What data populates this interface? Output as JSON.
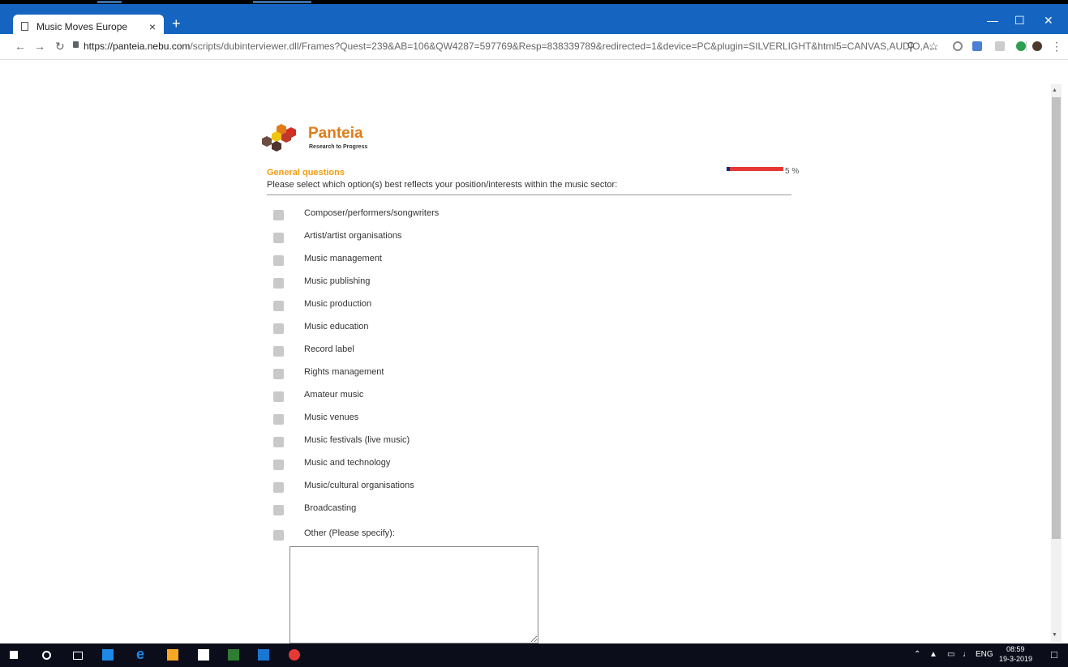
{
  "browser": {
    "tab_title": "Music Moves Europe",
    "tab_close": "×",
    "new_tab": "+",
    "url_host": "https://panteia.nebu.com",
    "url_path": "/scripts/dubinterviewer.dll/Frames?Quest=239&AB=106&QW4287=597769&Resp=838339789&redirected=1&device=PC&plugin=SILVERLIGHT&html5=CANVAS,AUDIO,A..."
  },
  "logo": {
    "name": "Panteia",
    "tagline": "Research to Progress",
    "colors": {
      "orange": "#e07c18",
      "yellow": "#f1c40f",
      "red": "#d62d20",
      "brown": "#6d4c41",
      "darkbrown": "#4e342e"
    }
  },
  "survey": {
    "section": "General questions",
    "question": "Please select which option(s) best reflects your position/interests within the music sector:",
    "progress_percent": 5,
    "progress_label": "5 %",
    "options": [
      "Composer/performers/songwriters",
      "Artist/artist organisations",
      "Music management",
      "Music publishing",
      "Music production",
      "Music education",
      "Record label",
      "Rights management",
      "Amateur music",
      "Music venues",
      "Music festivals (live music)",
      "Music and technology",
      "Music/cultural organisations",
      "Broadcasting",
      "Other (Please specify):"
    ]
  },
  "taskbar": {
    "lang": "ENG",
    "time": "08:59",
    "date": "19-3-2019"
  },
  "colors": {
    "chrome_blue": "#1565c0",
    "accent_orange": "#f39c12",
    "progress_red": "#e53935"
  }
}
